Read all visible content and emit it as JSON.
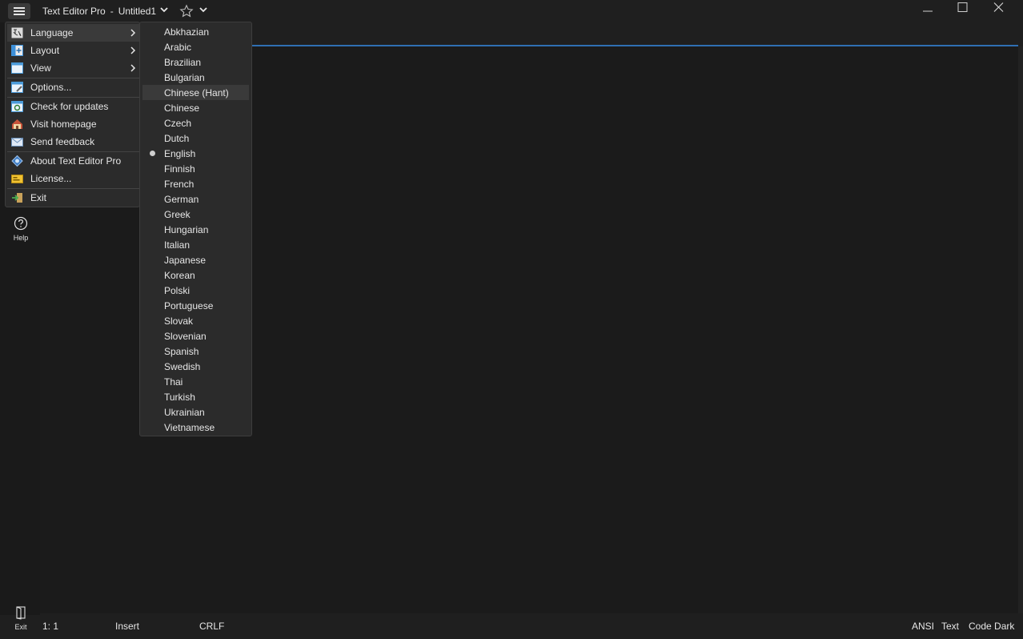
{
  "titlebar": {
    "app_name": "Text Editor Pro",
    "separator": "-",
    "document": "Untitled1"
  },
  "main_menu": {
    "items": [
      {
        "label": "Language",
        "icon": "language-icon",
        "has_submenu": true,
        "active": true
      },
      {
        "label": "Layout",
        "icon": "layout-icon",
        "has_submenu": true
      },
      {
        "label": "View",
        "icon": "view-icon",
        "has_submenu": true
      },
      {
        "label": "Options...",
        "icon": "options-icon"
      },
      {
        "label": "Check for updates",
        "icon": "updates-icon"
      },
      {
        "label": "Visit homepage",
        "icon": "homepage-icon"
      },
      {
        "label": "Send feedback",
        "icon": "feedback-icon"
      },
      {
        "label": "About Text Editor Pro",
        "icon": "about-icon"
      },
      {
        "label": "License...",
        "icon": "license-icon"
      },
      {
        "label": "Exit",
        "icon": "exit-icon"
      }
    ]
  },
  "language_submenu": {
    "items": [
      "Abkhazian",
      "Arabic",
      "Brazilian",
      "Bulgarian",
      "Chinese (Hant)",
      "Chinese",
      "Czech",
      "Dutch",
      "English",
      "Finnish",
      "French",
      "German",
      "Greek",
      "Hungarian",
      "Italian",
      "Japanese",
      "Korean",
      "Polski",
      "Portuguese",
      "Slovak",
      "Slovenian",
      "Spanish",
      "Swedish",
      "Thai",
      "Turkish",
      "Ukrainian",
      "Vietnamese"
    ],
    "hovered": "Chinese (Hant)",
    "selected": "English"
  },
  "left_toolbar": {
    "help_label": "Help",
    "exit_label": "Exit"
  },
  "statusbar": {
    "position": "1: 1",
    "mode": "Insert",
    "line_ending": "CRLF",
    "encoding": "ANSI",
    "highlighter": "Text",
    "theme": "Code Dark"
  },
  "colors": {
    "accent": "#2f6fb3",
    "background": "#1b1b1b",
    "menu": "#2b2b2b"
  }
}
